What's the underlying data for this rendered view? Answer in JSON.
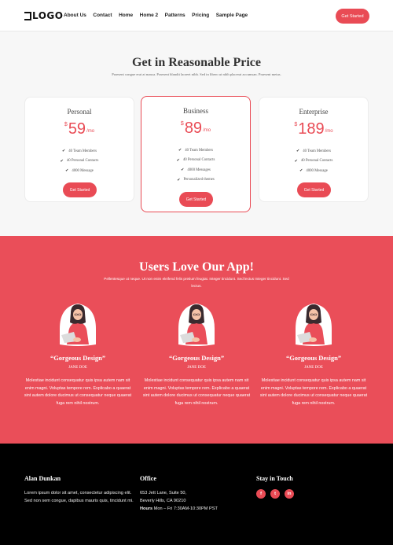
{
  "header": {
    "logo_text": "LOGO",
    "nav": [
      "About Us",
      "Contact",
      "Home",
      "Home 2",
      "Patterns",
      "Pricing",
      "Sample Page"
    ],
    "cta_label": "Get Started"
  },
  "pricing": {
    "title": "Get in Reasonable Price",
    "subtitle": "Praesent congue erat at massa. Praesent blandit laoreet nibh. Sed in libero ut nibh placerat accumsan. Praesent metus.",
    "plans": [
      {
        "name": "Personal",
        "currency": "$",
        "amount": "59",
        "period": "/mo",
        "features": [
          "40 Team Members",
          "40 Personal Contacts",
          "4000 Message"
        ],
        "button": "Get Started"
      },
      {
        "name": "Business",
        "currency": "$",
        "amount": "89",
        "period": "/mo",
        "features": [
          "40 Team Members",
          "40 Personal Contacts",
          "4000 Messages",
          "Personalized themes"
        ],
        "button": "Get Started"
      },
      {
        "name": "Enterprise",
        "currency": "$",
        "amount": "189",
        "period": "/mo",
        "features": [
          "40 Team Members",
          "40 Personal Contacts",
          "4000 Message"
        ],
        "button": "Get Started"
      }
    ]
  },
  "testimonials": {
    "title": "Users Love Our App!",
    "subtitle": "Pellentesque ut neque. Ut non enim eleifend felis pretium feugiat. Integer tincidunt. Sed lectus Integer tincidunt. Sed lectus.",
    "items": [
      {
        "quote": "“Gorgeous Design”",
        "name": "JANE DOE",
        "body": "Molestiae incidunt consequatur quis ipsa autem nam sit enim magni. Voluptas tempore rem. Explicabo a quaerat sint autem dolore ducimus ut consequatur neque quaerat fuga rem nihil nostrum."
      },
      {
        "quote": "“Gorgeous Design”",
        "name": "JANE DOE",
        "body": "Molestiae incidunt consequatur quis ipsa autem nam sit enim magni. Voluptas tempore rem. Explicabo a quaerat sint autem dolore ducimus ut consequatur neque quaerat fuga rem nihil nostrum."
      },
      {
        "quote": "“Gorgeous Design”",
        "name": "JANE DOE",
        "body": "Molestiae incidunt consequatur quis ipsa autem nam sit enim magni. Voluptas tempore rem. Explicabo a quaerat sint autem dolore ducimus ut consequatur neque quaerat fuga rem nihil nostrum."
      }
    ]
  },
  "footer": {
    "about": {
      "heading": "Alan Dunkan",
      "text": "Lorem ipsum dolor sit amet, consectetur adipiscing elit. Sed non sem congue, dapibus mauris quis, tincidunt mi."
    },
    "office": {
      "heading": "Office",
      "address1": "653 Jett Lane, Suite 50,",
      "address2": "Beverly Hills, CA 90210",
      "hours_label": "Hours",
      "hours": "Mon – Fri 7:30AM-10:30PM PST"
    },
    "social": {
      "heading": "Stay in Touch",
      "icons": [
        "f",
        "t",
        "in"
      ]
    }
  },
  "colors": {
    "accent": "#e94b55",
    "footer_bg": "#000000"
  }
}
